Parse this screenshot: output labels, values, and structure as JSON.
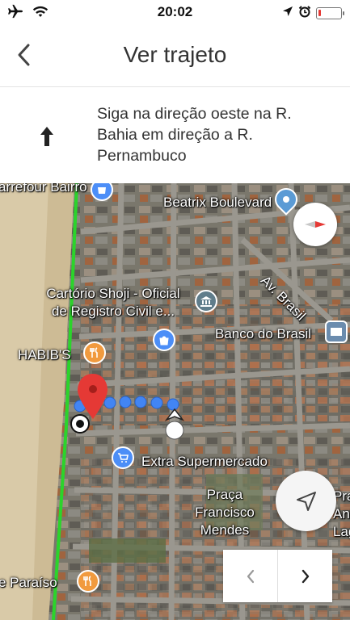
{
  "status_bar": {
    "time": "20:02",
    "left_icons": [
      "airplane-icon",
      "wifi-icon"
    ],
    "right_icons": [
      "location-arrow-icon",
      "alarm-icon",
      "battery-icon"
    ],
    "battery_level": 0.12,
    "battery_color": "#e53935"
  },
  "header": {
    "back_icon": "chevron-left-icon",
    "title": "Ver trajeto"
  },
  "direction": {
    "icon": "arrow-up-icon",
    "text": "Siga na direção oeste na R. Bahia em direção a R. Pernambuco"
  },
  "map": {
    "labels": {
      "carrefour": "arrefour Bairro",
      "beatrix": "Beatrix Boulevard",
      "av_brasil": "Av. Brasil",
      "cartorio_line1": "Cartório Shoji - Oficial",
      "cartorio_line2": "de Registro Civil e...",
      "banco": "Banco do Brasil",
      "habibs": "HABIB'S",
      "extra": "Extra Supermercado",
      "praca_line1": "Praça",
      "praca_line2": "Francisco",
      "praca_line3": "Mendes",
      "praca2_line1": "Praç",
      "praca2_line2": "Antoni",
      "praca2_line3": "Lagat",
      "paraiso": "e Paraíso"
    },
    "route_color": "#4285f4",
    "pin_color": "#e53935",
    "road_color": "#2bd42b"
  },
  "controls": {
    "compass_icon": "compass-icon",
    "recenter_icon": "navigation-arrow-icon",
    "prev_icon": "chevron-left-icon",
    "next_icon": "chevron-right-icon"
  }
}
